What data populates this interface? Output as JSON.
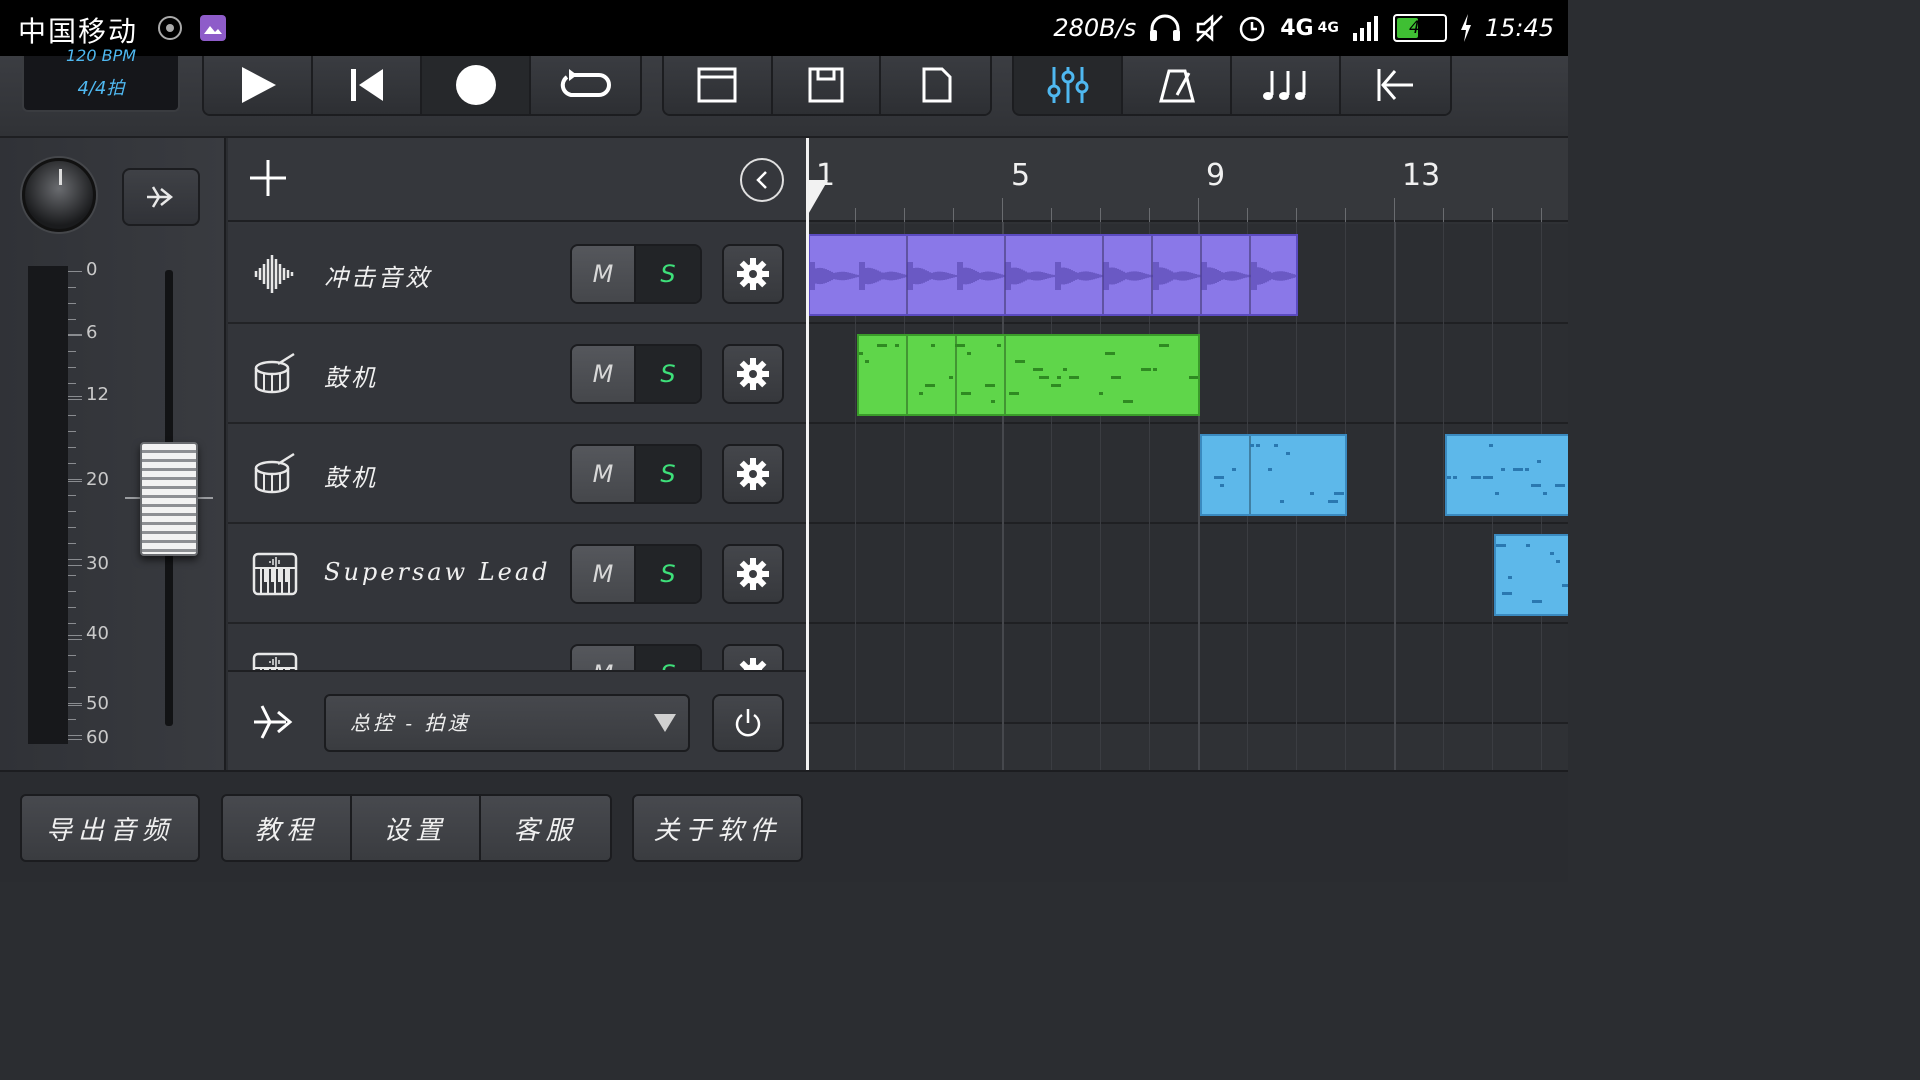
{
  "status_bar": {
    "carrier": "中国移动",
    "net_speed": "280B/s",
    "network": "4G",
    "network2": "4G",
    "battery_level": "42",
    "time": "15:45"
  },
  "toolbar": {
    "tempo_bpm": "120 BPM",
    "time_signature": "4/4拍",
    "transport": [
      "play-icon",
      "skip-back-icon",
      "record-icon",
      "loop-icon"
    ],
    "view": [
      "window-icon",
      "save-icon",
      "new-file-icon"
    ],
    "tools": [
      "mixer-icon",
      "metronome-icon",
      "notes-icon",
      "back-icon"
    ],
    "accent": "#4fb8f0"
  },
  "mixer": {
    "scale": [
      "0",
      "6",
      "12",
      "20",
      "30",
      "40",
      "50",
      "60"
    ]
  },
  "tracks": [
    {
      "icon": "waveform-icon",
      "name": "冲击音效",
      "mute": "M",
      "solo": "S"
    },
    {
      "icon": "drum-icon",
      "name": "鼓机",
      "mute": "M",
      "solo": "S"
    },
    {
      "icon": "drum-icon",
      "name": "鼓机",
      "mute": "M",
      "solo": "S"
    },
    {
      "icon": "keyboard-icon",
      "name": "Supersaw Lead",
      "mute": "M",
      "solo": "S"
    },
    {
      "icon": "keyboard-icon",
      "name": "",
      "mute": "M",
      "solo": "S"
    }
  ],
  "automation": {
    "selected": "总控 - 拍速"
  },
  "ruler": {
    "bars": [
      "1",
      "5",
      "9",
      "13"
    ]
  },
  "bottom": {
    "export": "导出音频",
    "tutorial": "教程",
    "settings": "设置",
    "support": "客服",
    "about": "关于软件"
  }
}
